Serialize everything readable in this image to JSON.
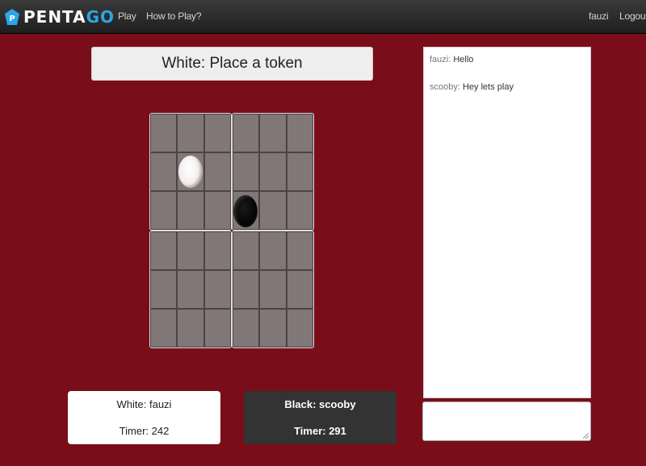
{
  "navbar": {
    "brand_part1": "PENTA",
    "brand_part2": "GO",
    "brand_icon_letter": "P",
    "brand_color": "#2ba6e8",
    "links": [
      {
        "label": "Play"
      },
      {
        "label": "How to Play?"
      }
    ],
    "username": "fauzi",
    "logout_label": "Logout"
  },
  "status": {
    "text": "White: Place a token"
  },
  "board": {
    "rows": 6,
    "cols": 6,
    "background": "#7a0d1a",
    "tokens": [
      {
        "color": "white",
        "row": 1,
        "col": 1
      },
      {
        "color": "black",
        "row": 2,
        "col": 3
      }
    ]
  },
  "players": {
    "white": {
      "label": "White: fauzi",
      "timer": "Timer: 242"
    },
    "black": {
      "label": "Black: scooby",
      "timer": "Timer: 291"
    }
  },
  "chat": {
    "messages": [
      {
        "author": "fauzi:",
        "text": "Hello"
      },
      {
        "author": "scooby:",
        "text": "Hey lets play"
      }
    ],
    "input_value": ""
  }
}
